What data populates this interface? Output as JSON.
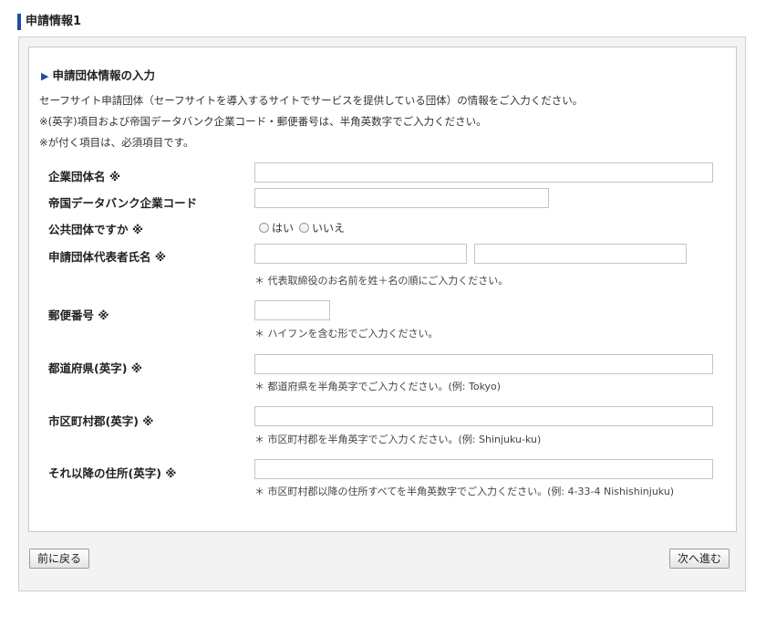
{
  "page_title": "申請情報1",
  "section": {
    "heading": "申請団体情報の入力",
    "desc_1": "セーフサイト申請団体（セーフサイトを導入するサイトでサービスを提供している団体）の情報をご入力ください。",
    "desc_2": "※(英字)項目および帝国データバンク企業コード・郵便番号は、半角英数字でご入力ください。",
    "desc_3": "※が付く項目は、必須項目です。"
  },
  "fields": {
    "company_name": {
      "label": "企業団体名 ※",
      "value": ""
    },
    "tdb_code": {
      "label": "帝国データバンク企業コード",
      "value": ""
    },
    "public_org": {
      "label": "公共団体ですか ※",
      "options": [
        "はい",
        "いいえ"
      ]
    },
    "rep_name": {
      "label": "申請団体代表者氏名 ※",
      "last_value": "",
      "first_value": "",
      "hint": "＊ 代表取締役のお名前を姓＋名の順にご入力ください。"
    },
    "postal_code": {
      "label": "郵便番号 ※",
      "value": "",
      "hint": "＊ ハイフンを含む形でご入力ください。"
    },
    "prefecture": {
      "label": "都道府県(英字) ※",
      "value": "",
      "hint": "＊ 都道府県を半角英字でご入力ください。(例: Tokyo)"
    },
    "city": {
      "label": "市区町村郡(英字) ※",
      "value": "",
      "hint": "＊ 市区町村郡を半角英字でご入力ください。(例: Shinjuku-ku)"
    },
    "address": {
      "label": "それ以降の住所(英字) ※",
      "value": "",
      "hint": "＊ 市区町村郡以降の住所すべてを半角英数字でご入力ください。(例: 4-33-4 Nishishinjuku)"
    }
  },
  "buttons": {
    "back": "前に戻る",
    "next": "次へ進む"
  },
  "colors": {
    "accent": "#1f4f9b",
    "panel_bg": "#f3f3f3",
    "border": "#c8c8c8"
  }
}
